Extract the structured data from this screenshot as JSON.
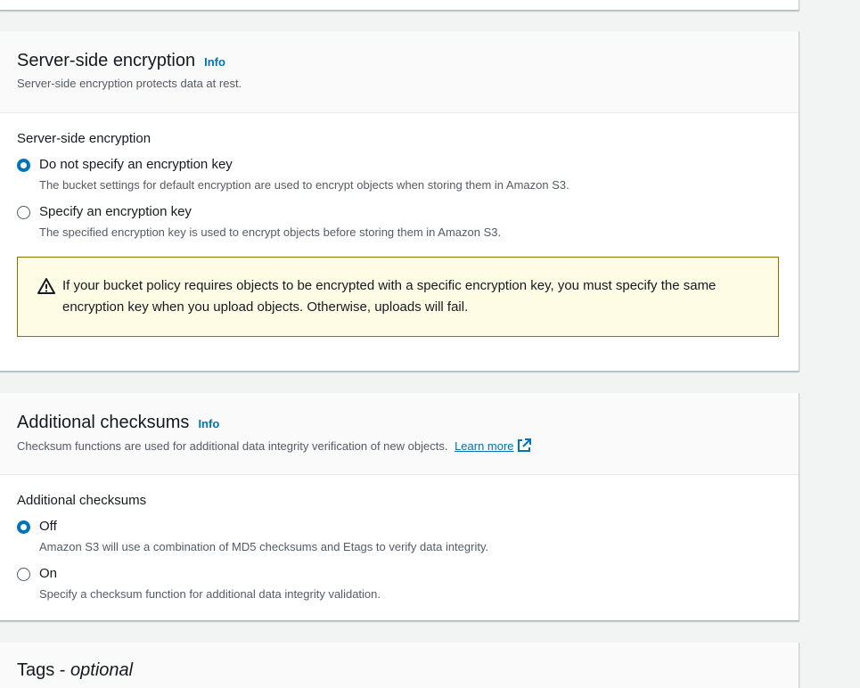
{
  "encryption": {
    "title": "Server-side encryption",
    "info": "Info",
    "description": "Server-side encryption protects data at rest.",
    "field_label": "Server-side encryption",
    "options": [
      {
        "label": "Do not specify an encryption key",
        "description": "The bucket settings for default encryption are used to encrypt objects when storing them in Amazon S3.",
        "checked": true
      },
      {
        "label": "Specify an encryption key",
        "description": "The specified encryption key is used to encrypt objects before storing them in Amazon S3.",
        "checked": false
      }
    ],
    "warning": "If your bucket policy requires objects to be encrypted with a specific encryption key, you must specify the same encryption key when you upload objects. Otherwise, uploads will fail."
  },
  "checksums": {
    "title": "Additional checksums",
    "info": "Info",
    "description": "Checksum functions are used for additional data integrity verification of new objects.",
    "learn_more": "Learn more",
    "field_label": "Additional checksums",
    "options": [
      {
        "label": "Off",
        "description": "Amazon S3 will use a combination of MD5 checksums and Etags to verify data integrity.",
        "checked": true
      },
      {
        "label": "On",
        "description": "Specify a checksum function for additional data integrity validation.",
        "checked": false
      }
    ]
  },
  "tags": {
    "title": "Tags - ",
    "optional": "optional"
  },
  "colors": {
    "accent": "#0073bb",
    "warning_bg": "#fffce6",
    "warning_border": "#8b6f00"
  }
}
